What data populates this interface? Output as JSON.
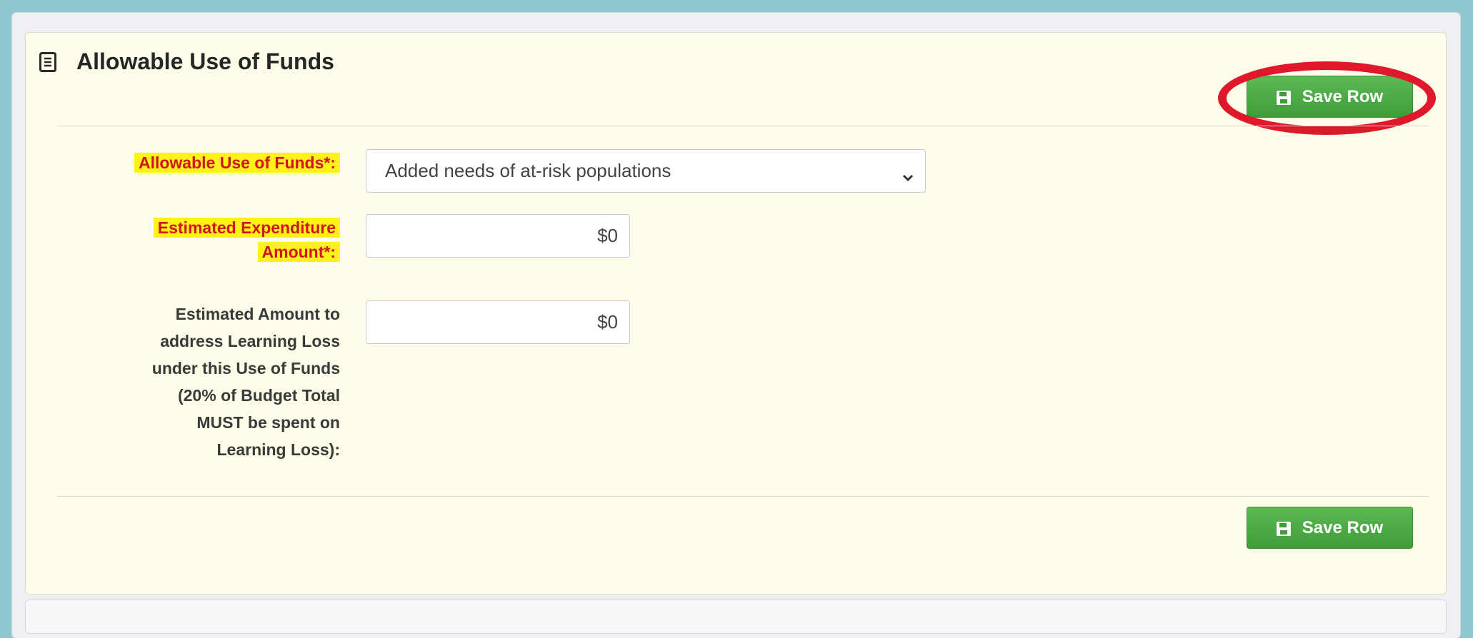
{
  "header": {
    "title": "Allowable Use of Funds",
    "title_icon": "document-list-icon"
  },
  "buttons": {
    "save_row_label": "Save Row",
    "save_icon": "floppy-disk-icon"
  },
  "form": {
    "use_of_funds": {
      "label": "Allowable Use of Funds*:",
      "selected": "Added needs of at-risk populations"
    },
    "expenditure": {
      "label_line1": "Estimated Expenditure",
      "label_line2": "Amount*:",
      "value": "$0"
    },
    "learning_loss": {
      "label_lines": [
        "Estimated Amount to",
        "address Learning Loss",
        "under this Use of Funds",
        "(20% of Budget Total",
        "MUST be spent on",
        "Learning Loss):"
      ],
      "value": "$0"
    }
  },
  "colors": {
    "accent_green": "#4cae45",
    "highlight_yellow": "#fff21a",
    "annotation_red": "#e0182c",
    "panel_bg": "#fdfde9"
  }
}
